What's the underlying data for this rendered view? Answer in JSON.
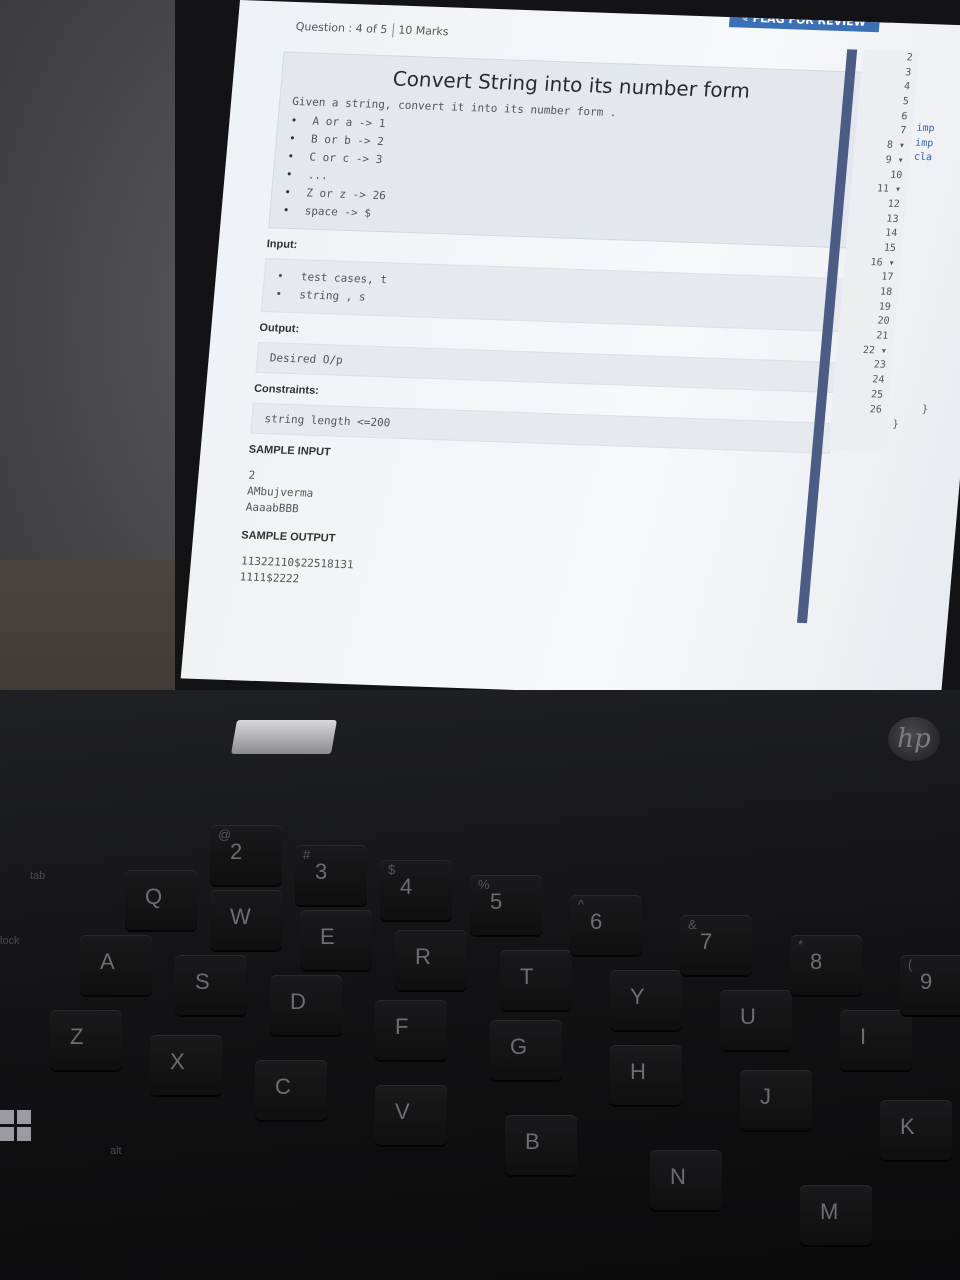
{
  "question": {
    "counter": "Question : 4 of 5",
    "marks": "10 Marks",
    "flag_label": "FLAG FOR REVIEW",
    "title": "Convert String into its number form",
    "description": "Given a string, convert it into its number form .",
    "rules": [
      "A or a -> 1",
      "B or b -> 2",
      "C or c -> 3",
      "...",
      "Z or z -> 26",
      "space -> $"
    ],
    "input_label": "Input:",
    "input_items": [
      "test cases, t",
      "string , s"
    ],
    "output_label": "Output:",
    "output_text": "Desired O/p",
    "constraints_label": "Constraints:",
    "constraints_text": "string length <=200",
    "sample_input_label": "SAMPLE INPUT",
    "sample_input": [
      "2",
      "AMbujverma",
      "AaaabBBB"
    ],
    "sample_output_label": "SAMPLE OUTPUT",
    "sample_output": [
      "11322110$22518131",
      "1111$2222"
    ]
  },
  "editor": {
    "line_numbers": [
      "2",
      "3",
      "4",
      "5",
      "6",
      "7",
      "8 ▾",
      "9 ▾",
      "10",
      "11 ▾",
      "12",
      "13",
      "14",
      "15",
      "16 ▾",
      "17",
      "18",
      "19",
      "20",
      "21",
      "22 ▾",
      "23",
      "24",
      "25",
      "26"
    ],
    "code_fragments": [
      "imp",
      "imp",
      "cla"
    ],
    "closing_brace_1": "}",
    "closing_brace_2": "}"
  },
  "laptop": {
    "brand": "hp"
  },
  "keyboard": {
    "keys": [
      {
        "label": "Q"
      },
      {
        "label": "W"
      },
      {
        "label": "E"
      },
      {
        "label": "R"
      },
      {
        "label": "T"
      },
      {
        "label": "Y"
      },
      {
        "label": "U"
      },
      {
        "label": "I"
      },
      {
        "label": "A"
      },
      {
        "label": "S"
      },
      {
        "label": "D"
      },
      {
        "label": "F"
      },
      {
        "label": "G"
      },
      {
        "label": "H"
      },
      {
        "label": "J"
      },
      {
        "label": "K"
      },
      {
        "label": "Z"
      },
      {
        "label": "X"
      },
      {
        "label": "C"
      },
      {
        "label": "V"
      },
      {
        "label": "B"
      },
      {
        "label": "N"
      },
      {
        "label": "M"
      },
      {
        "label": "2",
        "sym": "@"
      },
      {
        "label": "3",
        "sym": "#"
      },
      {
        "label": "4",
        "sym": "$"
      },
      {
        "label": "5",
        "sym": "%"
      },
      {
        "label": "6",
        "sym": "^"
      },
      {
        "label": "7",
        "sym": "&"
      },
      {
        "label": "8",
        "sym": "*"
      },
      {
        "label": "9",
        "sym": "("
      }
    ],
    "alt_label": "alt",
    "tab_label": "tab",
    "lock_label": "lock"
  }
}
